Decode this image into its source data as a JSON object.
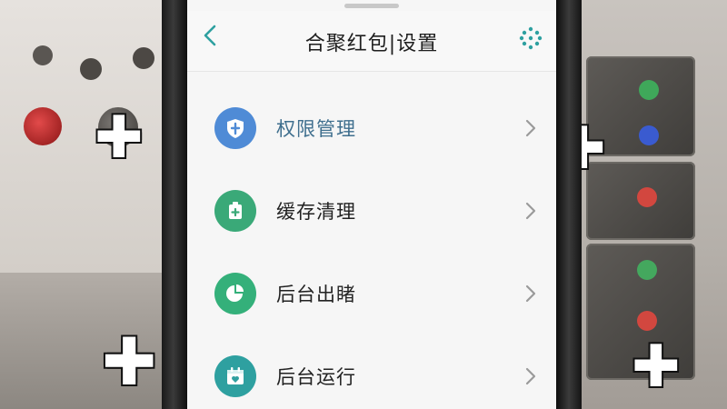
{
  "header": {
    "title": "合聚红包|设置",
    "back_icon": "chevron-left-icon",
    "menu_icon": "dots-grid-icon"
  },
  "settings": {
    "items": [
      {
        "label": "权限管理",
        "icon": "shield-icon",
        "color": "#4f8bd6",
        "label_color": "#3f6f8e"
      },
      {
        "label": "缓存清理",
        "icon": "cleanup-icon",
        "color": "#3aa978",
        "label_color": "#222222"
      },
      {
        "label": "后台出睹",
        "icon": "pie-chart-icon",
        "color": "#34b07a",
        "label_color": "#222222"
      },
      {
        "label": "后台运行",
        "icon": "calendar-icon",
        "color": "#2ea0a0",
        "label_color": "#222222"
      }
    ]
  },
  "colors": {
    "accent": "#2ea0a0",
    "background": "#f6f6f6"
  }
}
